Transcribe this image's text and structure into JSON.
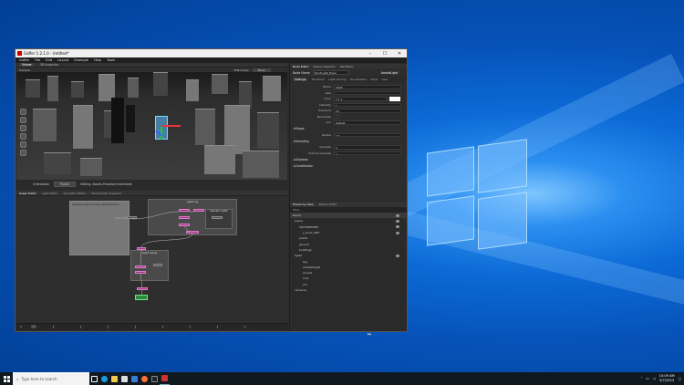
{
  "window": {
    "title": "Gaffer 1.2.1.0 - Untitled*",
    "controls": [
      "–",
      "☐",
      "✕"
    ]
  },
  "menu": [
    "Gaffer",
    "File",
    "Edit",
    "Layout",
    "Example",
    "Help",
    "Tools"
  ],
  "viewer": {
    "tabs": [
      "Viewer",
      "3D Inspector"
    ],
    "toolbar": [
      "Camera",
      "Edit Scope",
      "None"
    ],
    "status_label": "Orientation",
    "status_value": "Parent",
    "status_note": "Editing: Assets.Transform.transform"
  },
  "node_editor": {
    "tabs": [
      "Node Editor",
      "Scene Inspector",
      "Set Editor"
    ],
    "node_name_label": "Node Name",
    "node_name_value": "PointLight_Basic",
    "node_type": "ArnoldLight",
    "subtabs": [
      "Settings",
      "Transform",
      "Light Linking",
      "Visualisation",
      "Node",
      "User"
    ],
    "props": [
      {
        "label": "Name",
        "value": "/light"
      },
      {
        "label": "Sets",
        "value": ""
      },
      {
        "label": "Color",
        "value": "1    1    1"
      },
      {
        "label": "Intensity",
        "value": "1"
      },
      {
        "label": "Exposure",
        "value": "10"
      },
      {
        "label": "Normalize",
        "value": "✓"
      },
      {
        "label": "Aov",
        "value": "default"
      }
    ],
    "sections": [
      "Shape",
      "Sampling",
      "Shadows",
      "Contribution"
    ],
    "shape_props": [
      {
        "label": "Radius",
        "value": "0.5"
      }
    ],
    "sampling_props": [
      {
        "label": "Samples",
        "value": "1"
      },
      {
        "label": "Volume Samples",
        "value": "2"
      }
    ]
  },
  "graph_editor": {
    "tabs": [
      "Graph Editor",
      "Light Editor",
      "Animation Editor",
      "PrimitiveVar Inspector"
    ],
    "backdrop_title": "Light rig",
    "group_title": "Light setup",
    "sub_title": "Operator lights",
    "note_title": "Animated Light Linking by default behavior"
  },
  "hierarchy": {
    "tabs": [
      "Hierarchy View",
      "Python Editor"
    ],
    "filter_placeholder": "Filter...",
    "tree": [
      {
        "label": "Name",
        "depth": 0
      },
      {
        "label": "scene",
        "depth": 1
      },
      {
        "label": "SHOTPRIMSET",
        "depth": 2
      },
      {
        "label": "j_scout_GRP",
        "depth": 3
      },
      {
        "label": "plants",
        "depth": 2
      },
      {
        "label": "ground",
        "depth": 2
      },
      {
        "label": "buildings",
        "depth": 2
      },
      {
        "label": "lights",
        "depth": 1
      },
      {
        "label": "key",
        "depth": 2
      },
      {
        "label": "ambientlight",
        "depth": 2
      },
      {
        "label": "accent",
        "depth": 2
      },
      {
        "label": "rock",
        "depth": 2
      },
      {
        "label": "rim",
        "depth": 2
      },
      {
        "label": "cameras",
        "depth": 1
      }
    ]
  },
  "timeline": {
    "start": "1",
    "end": "100",
    "current": "1"
  },
  "taskbar": {
    "search_placeholder": "Type here to search",
    "time": "10:09 AM",
    "date": "3/7/2023"
  }
}
